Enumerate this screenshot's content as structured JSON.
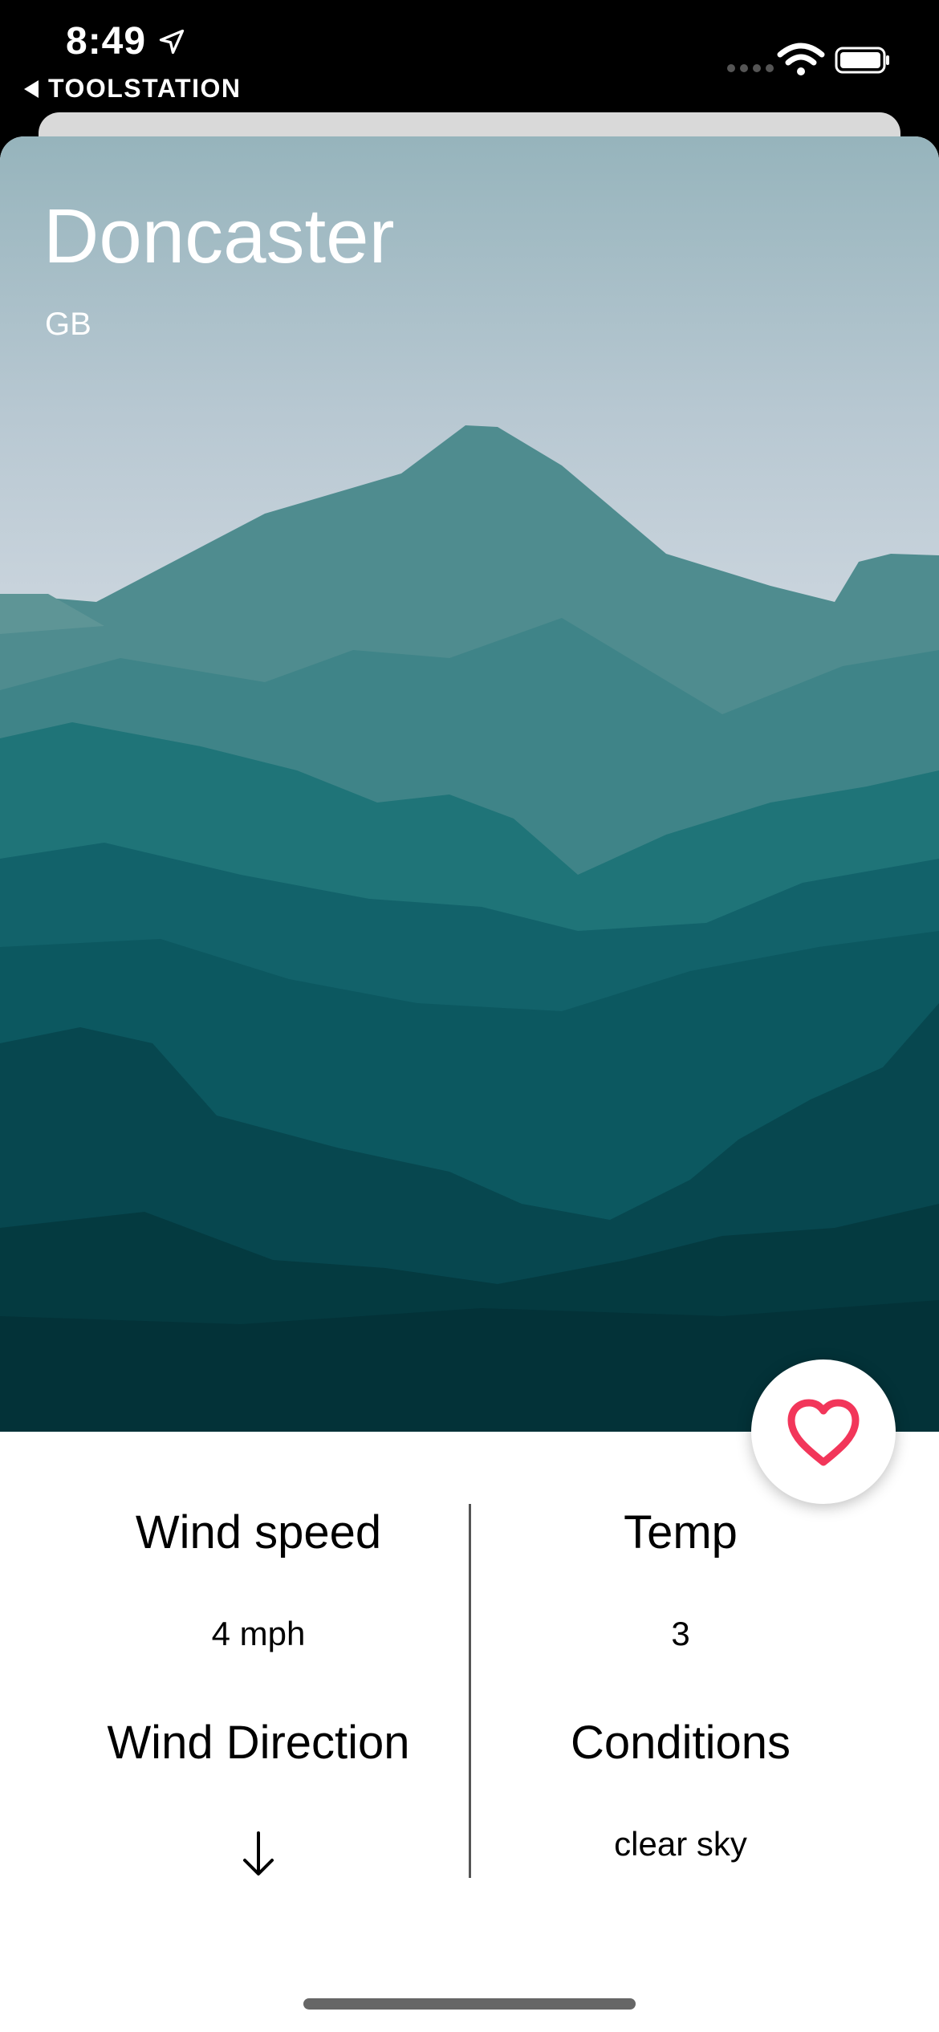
{
  "status_bar": {
    "time": "8:49",
    "back_label": "TOOLSTATION",
    "icons": [
      "location-arrow-icon",
      "cellular-signal-icon",
      "wifi-icon",
      "battery-icon"
    ]
  },
  "location": {
    "city": "Doncaster",
    "country": "GB"
  },
  "favorite": {
    "icon": "heart-icon",
    "color": "#f2365a"
  },
  "weather": {
    "wind_speed_label": "Wind speed",
    "wind_speed_value": "4 mph",
    "temp_label": "Temp",
    "temp_value": "3",
    "wind_direction_label": "Wind Direction",
    "wind_direction_icon": "arrow-down-icon",
    "conditions_label": "Conditions",
    "conditions_value": "clear sky"
  }
}
